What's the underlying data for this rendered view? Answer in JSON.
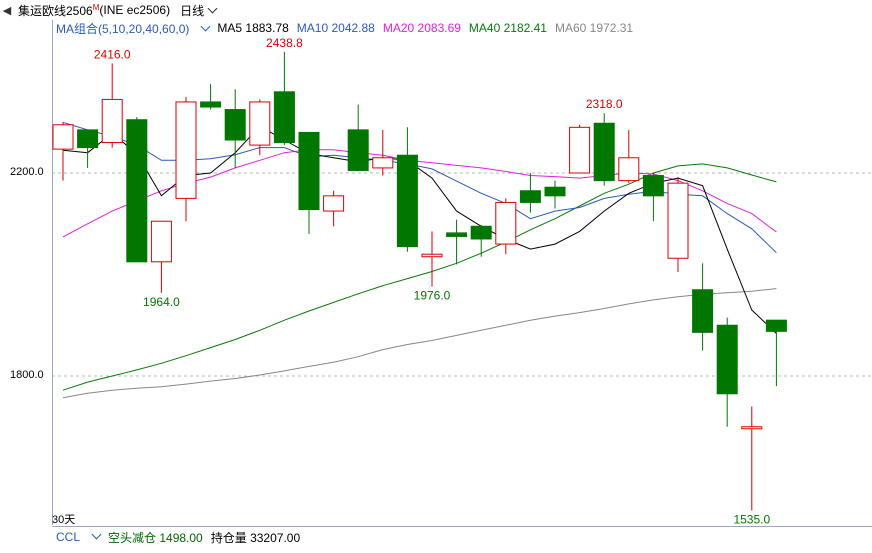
{
  "header": {
    "arrow_label": "◀",
    "title": "集运欧线2506",
    "title_marker": "M",
    "code": "(INE ec2506)",
    "period": "日线"
  },
  "ma_legend": {
    "group": "MA组合(5,10,20,40,60,0)",
    "ma5": "MA5 1883.78",
    "ma10": "MA10 2042.88",
    "ma20": "MA20 2083.69",
    "ma40": "MA40 2182.41",
    "ma60": "MA60 1972.31"
  },
  "y_axis": {
    "labels": [
      "2200.0",
      "1800.0"
    ]
  },
  "period_count": "30天",
  "bottom": {
    "ccl": "CCL",
    "short_reduce": "空头减仓 1498.00",
    "open_interest": "持仓量 33207.00"
  },
  "colors": {
    "up": "#dd0000",
    "down": "#007700",
    "ma5": "#000000",
    "ma10": "#2a5bbf",
    "ma20": "#e020e0",
    "ma40": "#0a7a0a",
    "ma60": "#888888"
  },
  "chart_data": {
    "type": "candlestick",
    "y_range": [
      1520,
      2460
    ],
    "candles": [
      {
        "o": 2247,
        "c": 2295,
        "h": 2300,
        "l": 2185
      },
      {
        "o": 2285,
        "c": 2250,
        "h": 2285,
        "l": 2210
      },
      {
        "o": 2260,
        "c": 2345,
        "h": 2416,
        "l": 2250
      },
      {
        "o": 2305,
        "c": 2025,
        "h": 2310,
        "l": 2025
      },
      {
        "o": 2025,
        "c": 2105,
        "h": 2105,
        "l": 1964
      },
      {
        "o": 2150,
        "c": 2340,
        "h": 2350,
        "l": 2105
      },
      {
        "o": 2340,
        "c": 2330,
        "h": 2375,
        "l": 2325
      },
      {
        "o": 2325,
        "c": 2265,
        "h": 2365,
        "l": 2210
      },
      {
        "o": 2255,
        "c": 2340,
        "h": 2345,
        "l": 2235
      },
      {
        "o": 2360,
        "c": 2260,
        "h": 2438.8,
        "l": 2255
      },
      {
        "o": 2280,
        "c": 2128,
        "h": 2280,
        "l": 2080
      },
      {
        "o": 2125,
        "c": 2155,
        "h": 2165,
        "l": 2095
      },
      {
        "o": 2285,
        "c": 2205,
        "h": 2335,
        "l": 2205
      },
      {
        "o": 2210,
        "c": 2230,
        "h": 2285,
        "l": 2195
      },
      {
        "o": 2235,
        "c": 2055,
        "h": 2290,
        "l": 2045
      },
      {
        "o": 2035,
        "c": 2040,
        "h": 2085,
        "l": 1976
      },
      {
        "o": 2082,
        "c": 2075,
        "h": 2108,
        "l": 2020
      },
      {
        "o": 2095,
        "c": 2070,
        "h": 2098,
        "l": 2035
      },
      {
        "o": 2060,
        "c": 2142,
        "h": 2150,
        "l": 2040
      },
      {
        "o": 2165,
        "c": 2142,
        "h": 2200,
        "l": 2122
      },
      {
        "o": 2172,
        "c": 2155,
        "h": 2185,
        "l": 2130
      },
      {
        "o": 2200,
        "c": 2290,
        "h": 2295,
        "l": 2200
      },
      {
        "o": 2298,
        "c": 2185,
        "h": 2318,
        "l": 2175
      },
      {
        "o": 2185,
        "c": 2230,
        "h": 2285,
        "l": 2180
      },
      {
        "o": 2195,
        "c": 2155,
        "h": 2200,
        "l": 2105
      },
      {
        "o": 2032,
        "c": 2180,
        "h": 2192,
        "l": 2005
      },
      {
        "o": 1970,
        "c": 1886,
        "h": 2022,
        "l": 1850
      },
      {
        "o": 1900,
        "c": 1765,
        "h": 1915,
        "l": 1700
      },
      {
        "o": 1696,
        "c": 1700,
        "h": 1740,
        "l": 1535
      },
      {
        "o": 1910,
        "c": 1888,
        "h": 1910,
        "l": 1780
      }
    ],
    "ma5": [
      2245,
      2240,
      2278,
      2238,
      2155,
      2195,
      2200,
      2240,
      2292,
      2265,
      2238,
      2230,
      2222,
      2230,
      2225,
      2190,
      2125,
      2095,
      2070,
      2050,
      2060,
      2085,
      2125,
      2160,
      2180,
      2190,
      2175,
      2050,
      1930,
      1883.78
    ],
    "ma10": [
      2300,
      2285,
      2272,
      2255,
      2225,
      2225,
      2228,
      2236,
      2250,
      2250,
      2232,
      2235,
      2230,
      2225,
      2218,
      2208,
      2184,
      2160,
      2140,
      2110,
      2125,
      2132,
      2150,
      2158,
      2164,
      2158,
      2155,
      2120,
      2090,
      2042.88
    ],
    "ma20": [
      2074,
      2100,
      2125,
      2145,
      2165,
      2180,
      2192,
      2210,
      2225,
      2240,
      2246,
      2246,
      2240,
      2235,
      2225,
      2220,
      2215,
      2210,
      2203,
      2195,
      2193,
      2190,
      2195,
      2200,
      2198,
      2185,
      2165,
      2140,
      2120,
      2083.69
    ],
    "ma40": [
      1772,
      1788,
      1800,
      1812,
      1825,
      1840,
      1856,
      1872,
      1890,
      1910,
      1928,
      1945,
      1962,
      1978,
      1992,
      2006,
      2022,
      2042,
      2064,
      2088,
      2110,
      2135,
      2160,
      2178,
      2200,
      2214,
      2218,
      2210,
      2196,
      2182.41
    ],
    "ma60": [
      1757,
      1766,
      1772,
      1776,
      1779,
      1784,
      1790,
      1795,
      1802,
      1810,
      1819,
      1827,
      1838,
      1852,
      1862,
      1870,
      1880,
      1890,
      1900,
      1910,
      1918,
      1925,
      1933,
      1942,
      1950,
      1956,
      1961,
      1964,
      1967,
      1972.31
    ],
    "annotations": [
      {
        "index": 2,
        "label": "2416.0",
        "position": "above",
        "color": "up"
      },
      {
        "index": 4,
        "label": "1964.0",
        "position": "below",
        "color": "down"
      },
      {
        "index": 9,
        "label": "2438.8",
        "position": "above",
        "color": "up"
      },
      {
        "index": 15,
        "label": "1976.0",
        "position": "below",
        "color": "down"
      },
      {
        "index": 22,
        "label": "2318.0",
        "position": "above",
        "color": "up"
      },
      {
        "index": 28,
        "label": "1535.0",
        "position": "below",
        "color": "down"
      }
    ],
    "reference_lines": [
      2200,
      1800
    ]
  }
}
